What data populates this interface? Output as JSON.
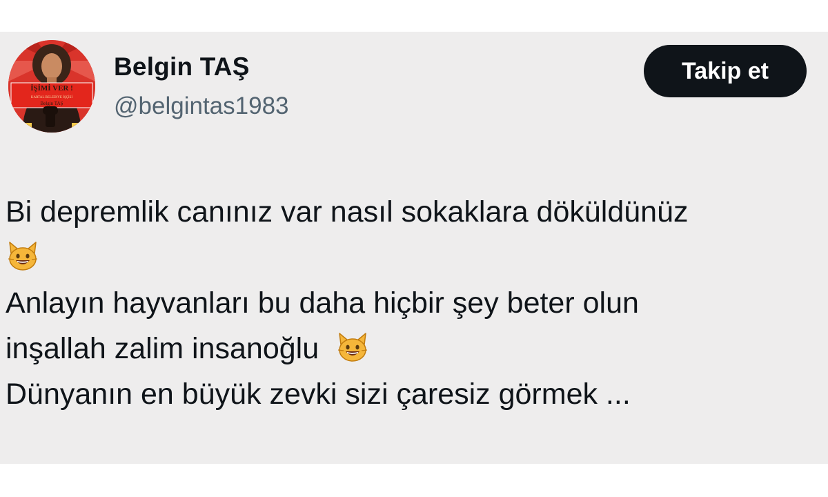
{
  "user": {
    "name": "Belgin TAŞ",
    "handle": "@belgintas1983",
    "avatar": {
      "sign_line_1": "İŞİMİ VER !",
      "sign_line_2": "KARTAL BELEDİYE İŞÇİSİ",
      "sign_line_3": "Belgin TAŞ"
    }
  },
  "follow_button": {
    "label": "Takip et"
  },
  "tweet": {
    "line_1": "Bi depremlik canınız var nasıl sokaklara döküldünüz",
    "line_1_emoji": "smiling-cat-emoji",
    "line_2": "Anlayın hayvanları bu daha hiçbir şey beter olun",
    "line_3": "inşallah zalim insanoğlu",
    "line_3_emoji": "smiling-cat-emoji",
    "line_4": "Dünyanın en büyük zevki sizi çaresiz görmek ..."
  },
  "colors": {
    "card_background": "#eeeded",
    "text_primary": "#0f1419",
    "text_secondary": "#536471",
    "button_background": "#0f1419",
    "avatar_red": "#d9342b"
  }
}
